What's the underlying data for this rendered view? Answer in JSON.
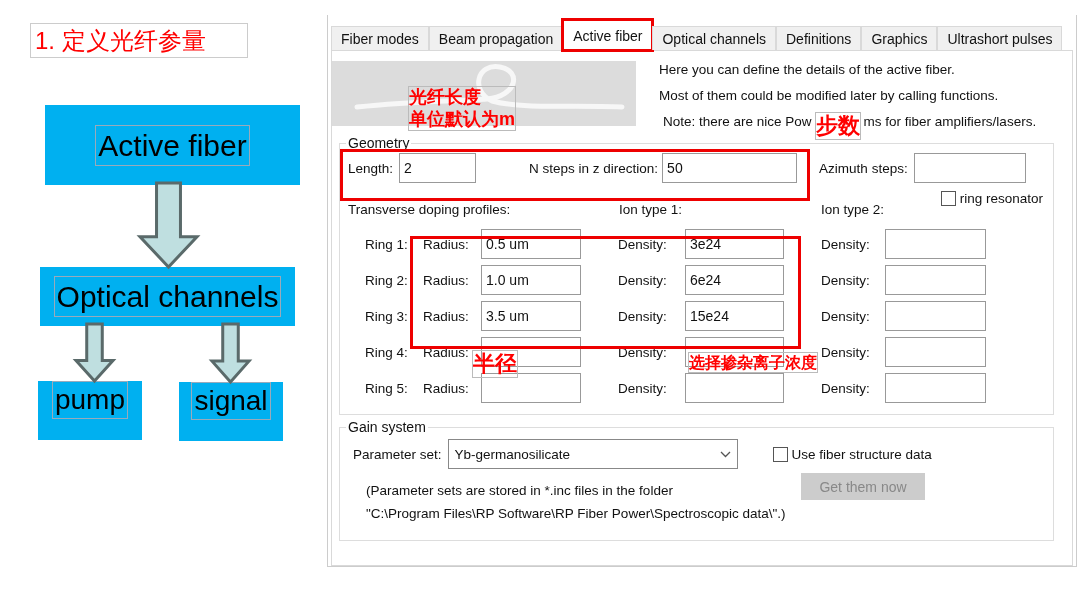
{
  "slide_title": "1. 定义光纤参量",
  "diagram": {
    "nodes": [
      {
        "label": "Active fiber",
        "kind": "main"
      },
      {
        "label": "Optical channels",
        "kind": "main"
      },
      {
        "label": "pump",
        "kind": "leaf"
      },
      {
        "label": "signal",
        "kind": "leaf"
      }
    ]
  },
  "window": {
    "tabs": [
      {
        "label": "Fiber modes",
        "selected": false
      },
      {
        "label": "Beam propagation",
        "selected": false
      },
      {
        "label": "Active fiber",
        "selected": true
      },
      {
        "label": "Optical channels",
        "selected": false
      },
      {
        "label": "Definitions",
        "selected": false
      },
      {
        "label": "Graphics",
        "selected": false
      },
      {
        "label": "Ultrashort pulses",
        "selected": false
      }
    ],
    "intro": [
      "Here you can define the details of the active fiber.",
      "Most of them could be modified later by calling functions."
    ],
    "note": [
      "Note: there are nice Pow",
      "ms for fiber amplifiers/lasers."
    ],
    "geometry": {
      "title": "Geometry",
      "length": {
        "label": "Length:",
        "value": "2"
      },
      "n_steps": {
        "label": "N steps in z direction:",
        "value": "50"
      },
      "azimuth": {
        "label": "Azimuth steps:"
      },
      "ring_resonator": {
        "label": "ring resonator",
        "checked": false
      },
      "headers": [
        "Transverse doping profiles:",
        "Ion type 1:",
        "Ion type 2:"
      ],
      "rings": [
        {
          "label": "Ring 1:",
          "radius_label": "Radius:",
          "radius": "0.5 um",
          "density1_label": "Density:",
          "density1": "3e24",
          "density2_label": "Density:"
        },
        {
          "label": "Ring 2:",
          "radius_label": "Radius:",
          "radius": "1.0 um",
          "density1_label": "Density:",
          "density1": "6e24",
          "density2_label": "Density:"
        },
        {
          "label": "Ring 3:",
          "radius_label": "Radius:",
          "radius": "3.5 um",
          "density1_label": "Density:",
          "density1": "15e24",
          "density2_label": "Density:"
        },
        {
          "label": "Ring 4:",
          "radius_label": "Radius:",
          "density1_label": "Density:",
          "density2_label": "Density:"
        },
        {
          "label": "Ring 5:",
          "radius_label": "Radius:",
          "density1_label": "Density:",
          "density2_label": "Density:"
        }
      ]
    },
    "gain": {
      "title": "Gain system",
      "param_label": "Parameter set:",
      "param_value": "Yb-germanosilicate",
      "use_structure": {
        "label": "Use fiber structure data",
        "checked": false
      },
      "button": {
        "label": "Get them now",
        "disabled": true
      },
      "note": [
        "(Parameter sets are stored in *.inc files in the folder",
        "\"C:\\Program Files\\RP Software\\RP Fiber Power\\Spectroscopic data\\\".)"
      ]
    }
  },
  "annotations": [
    {
      "lines": [
        "光纤长度",
        "单位默认为m"
      ]
    },
    {
      "lines": [
        "步数"
      ]
    },
    {
      "lines": [
        "半径"
      ]
    },
    {
      "lines": [
        "选择掺杂离子浓度"
      ]
    }
  ]
}
